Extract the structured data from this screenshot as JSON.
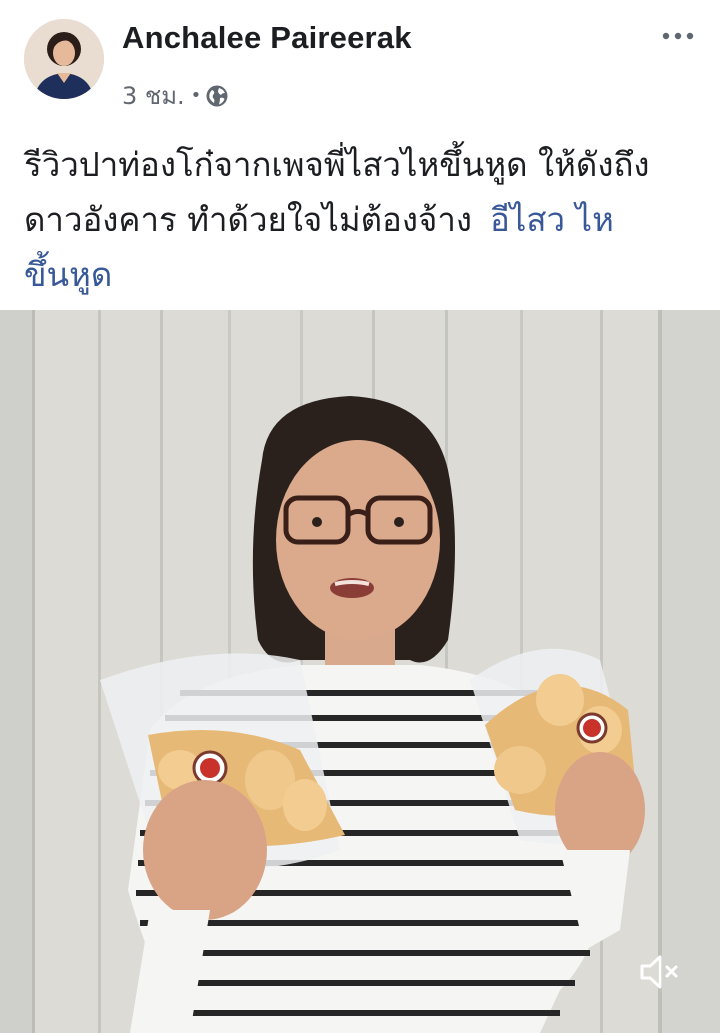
{
  "post": {
    "author_name": "Anchalee Paireerak",
    "timestamp": "3 ชม.",
    "separator": "•",
    "privacy_icon": "globe-icon",
    "more_icon": "more-options-icon",
    "text_lines": [
      "รีวิวปาท่องโก๋จากเพจพี่ไสวไหขึ้นหูด ให้ดังถึง",
      "ดาวอังคาร ทำด้วยใจไม่ต้องจ้าง"
    ],
    "hashtag_line_parts": [
      "อีไสว ไห",
      "ขึ้นหูด"
    ],
    "link_color": "#385898"
  },
  "media": {
    "type": "video",
    "mute_icon": "speaker-muted-icon"
  }
}
